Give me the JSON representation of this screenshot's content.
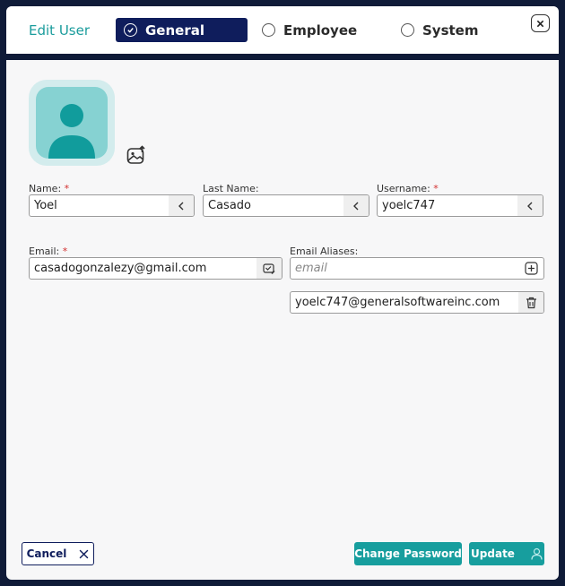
{
  "dialog": {
    "title": "Edit User",
    "tabs": [
      {
        "label": "General",
        "active": true
      },
      {
        "label": "Employee",
        "active": false
      },
      {
        "label": "System",
        "active": false
      }
    ],
    "close_icon": "close-icon"
  },
  "avatar": {
    "icon": "user-silhouette-icon",
    "upload_icon": "image-upload-icon"
  },
  "fields": {
    "name": {
      "label": "Name:",
      "required": "*",
      "value": "Yoel"
    },
    "last_name": {
      "label": "Last Name:",
      "value": "Casado"
    },
    "username": {
      "label": "Username:",
      "required": "*",
      "value": "yoelc747"
    },
    "email": {
      "label": "Email:",
      "required": "*",
      "value": "casadogonzalezy@gmail.com"
    },
    "email_aliases": {
      "label": "Email Aliases:",
      "placeholder": "email",
      "items": [
        "yoelc747@generalsoftwareinc.com"
      ]
    }
  },
  "footer": {
    "cancel_label": "Cancel",
    "change_password_label": "Change Password",
    "update_label": "Update"
  },
  "colors": {
    "accent": "#179e9e",
    "navy": "#0f1d5c",
    "required": "#d32f2f"
  }
}
